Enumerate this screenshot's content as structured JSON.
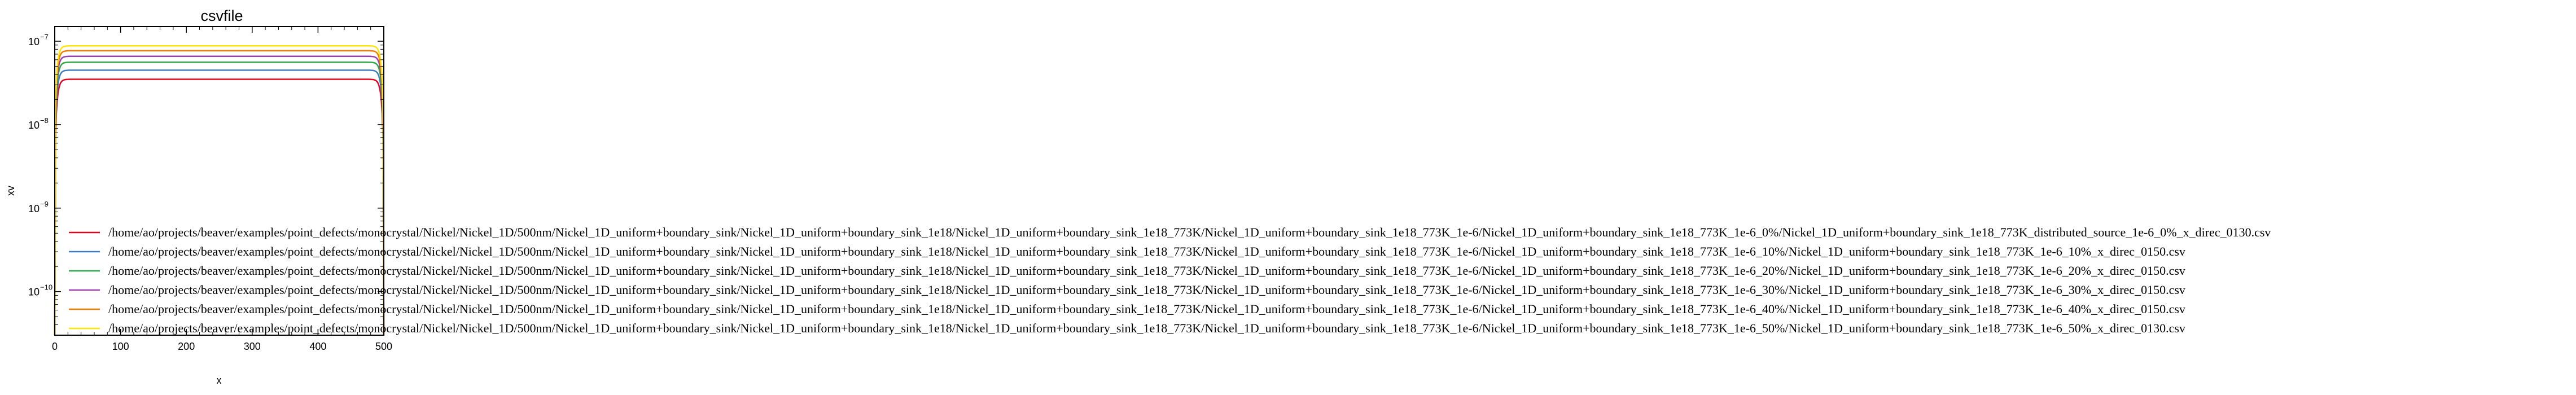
{
  "chart_data": {
    "type": "line",
    "title": "csvfile",
    "xlabel": "x",
    "ylabel": "xv",
    "xlim": [
      0,
      500
    ],
    "ylim": [
      3e-11,
      1.5e-07
    ],
    "yscale": "log",
    "grid": false,
    "legend_position": "center-left",
    "x_ticks": [
      0,
      100,
      200,
      300,
      400,
      500
    ],
    "x_tick_labels": [
      "0",
      "100",
      "200",
      "300",
      "400",
      "500"
    ],
    "y_ticks": [
      1e-10,
      1e-09,
      1e-08,
      1e-07
    ],
    "y_tick_labels": [
      "10",
      "10",
      "10",
      "10"
    ],
    "y_tick_exponents": [
      "−10",
      "−9",
      "−8",
      "−7"
    ],
    "series": [
      {
        "name": "/home/ao/projects/beaver/examples/point_defects/monocrystal/Nickel/Nickel_1D/500nm/Nickel_1D_uniform+boundary_sink/Nickel_1D_uniform+boundary_sink_1e18/Nickel_1D_uniform+boundary_sink_1e18_773K/Nickel_1D_uniform+boundary_sink_1e18_773K_1e-6/Nickel_1D_uniform+boundary_sink_1e18_773K_1e-6_0%/Nickel_1D_uniform+boundary_sink_1e18_773K_distributed_source_1e-6_0%_x_direc_0130.csv",
        "color": "#e8001c",
        "plateau": 3.5e-08
      },
      {
        "name": "/home/ao/projects/beaver/examples/point_defects/monocrystal/Nickel/Nickel_1D/500nm/Nickel_1D_uniform+boundary_sink/Nickel_1D_uniform+boundary_sink_1e18/Nickel_1D_uniform+boundary_sink_1e18_773K/Nickel_1D_uniform+boundary_sink_1e18_773K_1e-6/Nickel_1D_uniform+boundary_sink_1e18_773K_1e-6_10%/Nickel_1D_uniform+boundary_sink_1e18_773K_1e-6_10%_x_direc_0150.csv",
        "color": "#3a7dc0",
        "plateau": 4.5e-08
      },
      {
        "name": "/home/ao/projects/beaver/examples/point_defects/monocrystal/Nickel/Nickel_1D/500nm/Nickel_1D_uniform+boundary_sink/Nickel_1D_uniform+boundary_sink_1e18/Nickel_1D_uniform+boundary_sink_1e18_773K/Nickel_1D_uniform+boundary_sink_1e18_773K_1e-6/Nickel_1D_uniform+boundary_sink_1e18_773K_1e-6_20%/Nickel_1D_uniform+boundary_sink_1e18_773K_1e-6_20%_x_direc_0150.csv",
        "color": "#2ea84a",
        "plateau": 5.6e-08
      },
      {
        "name": "/home/ao/projects/beaver/examples/point_defects/monocrystal/Nickel/Nickel_1D/500nm/Nickel_1D_uniform+boundary_sink/Nickel_1D_uniform+boundary_sink_1e18/Nickel_1D_uniform+boundary_sink_1e18_773K/Nickel_1D_uniform+boundary_sink_1e18_773K_1e-6/Nickel_1D_uniform+boundary_sink_1e18_773K_1e-6_30%/Nickel_1D_uniform+boundary_sink_1e18_773K_1e-6_30%_x_direc_0150.csv",
        "color": "#9b3fb5",
        "plateau": 6.6e-08
      },
      {
        "name": "/home/ao/projects/beaver/examples/point_defects/monocrystal/Nickel/Nickel_1D/500nm/Nickel_1D_uniform+boundary_sink/Nickel_1D_uniform+boundary_sink_1e18/Nickel_1D_uniform+boundary_sink_1e18_773K/Nickel_1D_uniform+boundary_sink_1e18_773K_1e-6/Nickel_1D_uniform+boundary_sink_1e18_773K_1e-6_40%/Nickel_1D_uniform+boundary_sink_1e18_773K_1e-6_40%_x_direc_0150.csv",
        "color": "#f57c00",
        "plateau": 7.7e-08
      },
      {
        "name": "/home/ao/projects/beaver/examples/point_defects/monocrystal/Nickel/Nickel_1D/500nm/Nickel_1D_uniform+boundary_sink/Nickel_1D_uniform+boundary_sink_1e18/Nickel_1D_uniform+boundary_sink_1e18_773K/Nickel_1D_uniform+boundary_sink_1e18_773K_1e-6/Nickel_1D_uniform+boundary_sink_1e18_773K_1e-6_50%/Nickel_1D_uniform+boundary_sink_1e18_773K_1e-6_50%_x_direc_0130.csv",
        "color": "#ffe600",
        "plateau": 8.8e-08
      }
    ]
  }
}
